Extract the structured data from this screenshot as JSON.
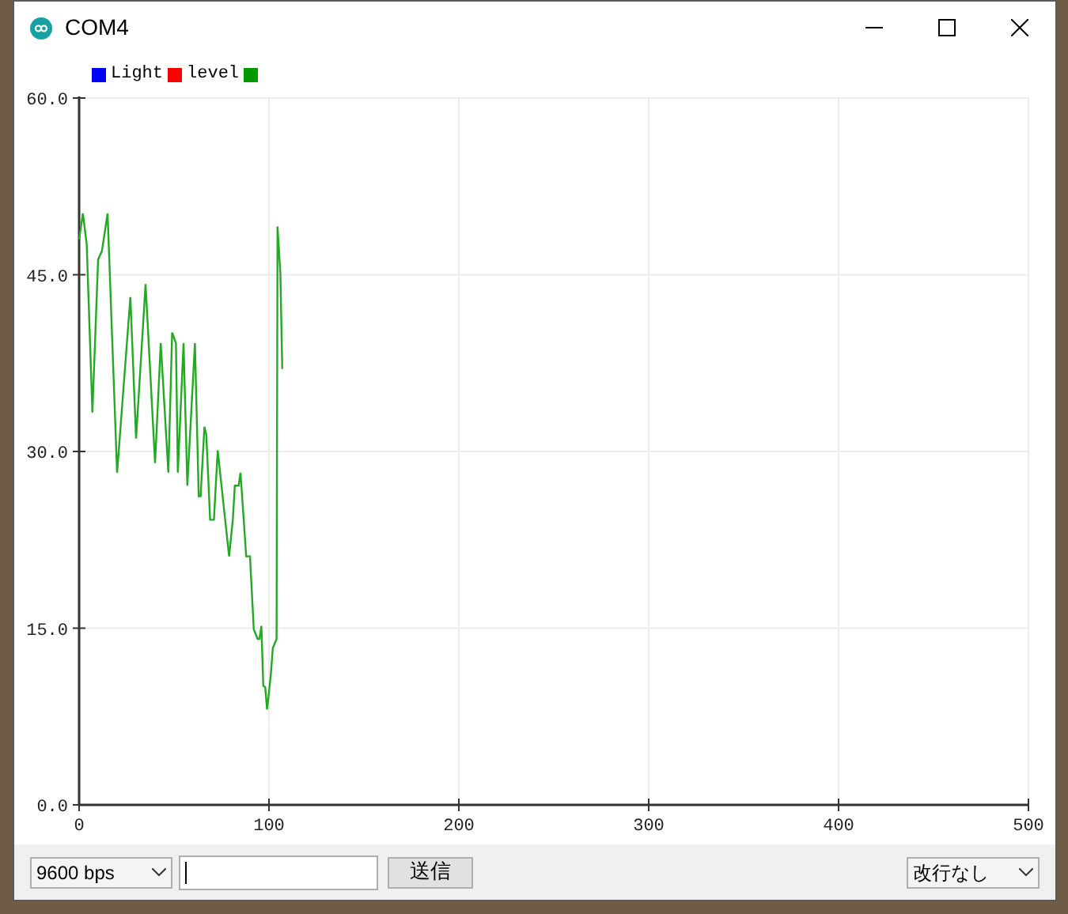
{
  "window": {
    "title": "COM4"
  },
  "legend": [
    {
      "label": "Light",
      "color": "#0000ff"
    },
    {
      "label": "level",
      "color": "#ff0000"
    },
    {
      "color": "#009900"
    }
  ],
  "chart_data": {
    "type": "line",
    "grid": true,
    "xlim": [
      0,
      500
    ],
    "ylim": [
      0,
      60
    ],
    "xticks": [
      0,
      100,
      200,
      300,
      400,
      500
    ],
    "yticks": [
      {
        "value": 0,
        "label": "0.0"
      },
      {
        "value": 15,
        "label": "15.0"
      },
      {
        "value": 30,
        "label": "30.0"
      },
      {
        "value": 45,
        "label": "45.0"
      },
      {
        "value": 60,
        "label": "60.0"
      }
    ],
    "x": [
      0,
      2,
      4,
      7,
      10,
      12,
      15,
      20,
      27,
      30,
      35,
      40,
      43,
      47,
      49,
      51,
      52,
      55,
      57,
      61,
      63,
      64,
      66,
      67,
      69,
      71,
      73,
      79,
      81,
      82,
      84,
      85,
      88,
      90,
      92,
      94,
      95,
      96,
      97,
      98,
      99,
      101,
      102,
      104,
      104.5,
      106,
      107
    ],
    "series": [
      {
        "color": "#22aa22",
        "values": [
          48,
          50.2,
          47.6,
          33.3,
          46.3,
          47,
          50.2,
          28.2,
          43.1,
          31.1,
          44.2,
          29,
          39.2,
          28.2,
          40.1,
          39.2,
          28.2,
          39.2,
          27.1,
          39.2,
          26.2,
          26.2,
          32.1,
          31.4,
          24.2,
          24.2,
          30.1,
          21.1,
          24.3,
          27.1,
          27.1,
          28.2,
          21.1,
          21.1,
          14.9,
          14.1,
          14.1,
          15.2,
          10.1,
          10,
          8.1,
          11.1,
          13.3,
          14.1,
          49.1,
          45.1,
          37
        ]
      }
    ]
  },
  "controls": {
    "baud": "9600 bps",
    "send": "送信",
    "line_ending": "改行なし"
  }
}
